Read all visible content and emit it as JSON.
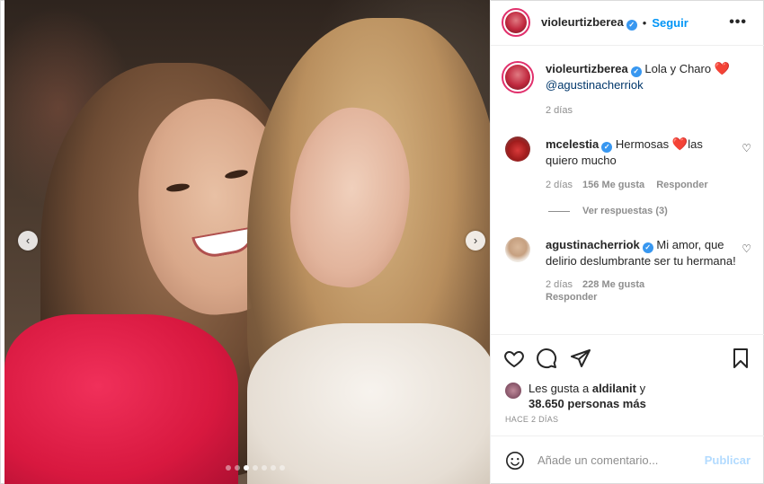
{
  "header": {
    "username": "violeurtizberea",
    "separator": "•",
    "follow_label": "Seguir",
    "more_icon": "more-options-icon"
  },
  "caption": {
    "username": "violeurtizberea",
    "text": "Lola y Charo",
    "emoji": "❤️",
    "mention": "@agustinacherriok",
    "time": "2 días"
  },
  "comments": [
    {
      "username": "mcelestia",
      "text_before": "Hermosas",
      "emoji": "❤️",
      "text_after": "las quiero mucho",
      "time": "2 días",
      "likes": "156 Me gusta",
      "reply": "Responder"
    },
    {
      "username": "agustinacherriok",
      "text": "Mi amor, que delirio deslumbrante ser tu hermana!",
      "time": "2 días",
      "likes": "228 Me gusta",
      "reply": "Responder"
    }
  ],
  "view_replies": "Ver respuestas (3)",
  "likes": {
    "prefix": "Les gusta a",
    "user": "aldilanit",
    "conj": "y",
    "others": "38.650 personas más"
  },
  "time_ago": "HACE 2 DÍAS",
  "comment_input": {
    "placeholder": "Añade un comentario...",
    "publish_label": "Publicar"
  },
  "carousel": {
    "total": 7,
    "active": 3,
    "prev_icon": "chevron-left-icon",
    "next_icon": "chevron-right-icon"
  },
  "colors": {
    "accent": "#0095f6",
    "verified": "#3897f0",
    "muted": "#8e8e8e",
    "publish_disabled": "#b3dbff"
  }
}
